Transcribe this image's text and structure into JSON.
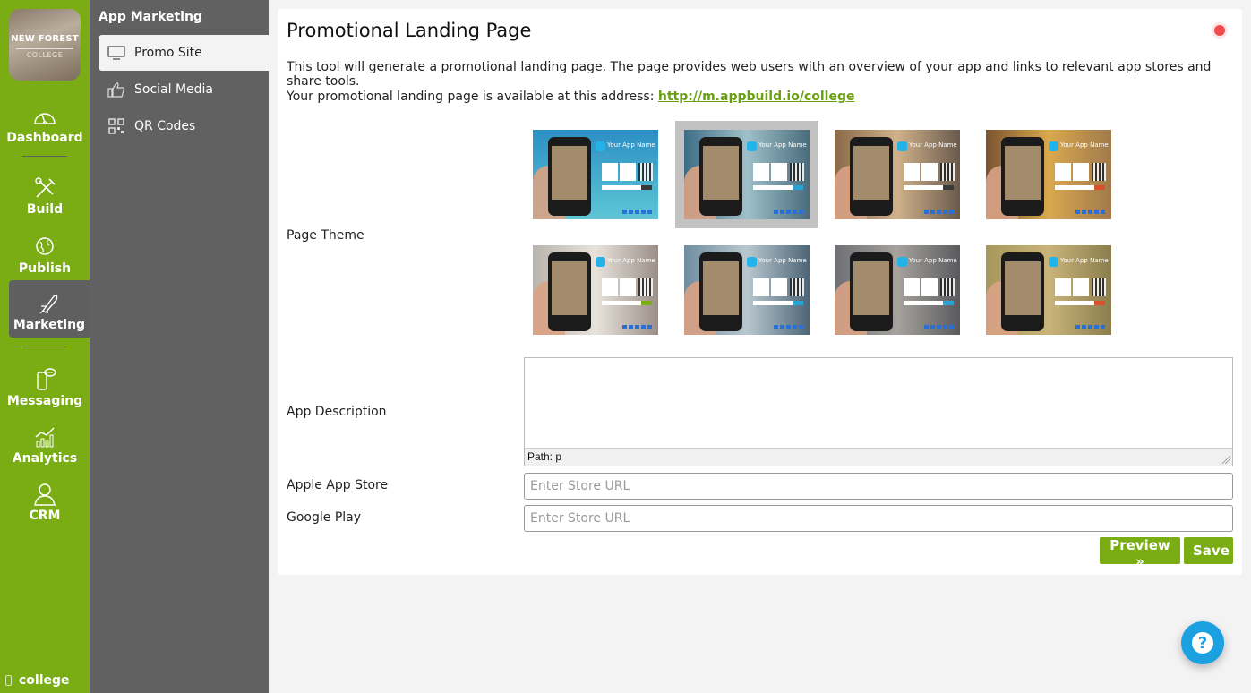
{
  "brand": {
    "logo_line1": "NEW FOREST",
    "logo_line2": "COLLEGE",
    "accent": "#7aac14",
    "subnav_bg": "#616161"
  },
  "nav": {
    "items": [
      {
        "label": "Dashboard",
        "icon": "gauge-icon"
      },
      {
        "label": "Build",
        "icon": "tools-icon"
      },
      {
        "label": "Publish",
        "icon": "globe-icon"
      },
      {
        "label": "Marketing",
        "icon": "rocket-icon",
        "active": true
      },
      {
        "label": "Messaging",
        "icon": "phone-chat-icon"
      },
      {
        "label": "Analytics",
        "icon": "chart-icon"
      },
      {
        "label": "CRM",
        "icon": "user-icon"
      }
    ],
    "footer_app": "college"
  },
  "subnav": {
    "title": "App Marketing",
    "items": [
      {
        "label": "Promo Site",
        "icon": "monitor-icon",
        "active": true
      },
      {
        "label": "Social Media",
        "icon": "thumbs-up-icon"
      },
      {
        "label": "QR Codes",
        "icon": "qr-code-icon"
      }
    ]
  },
  "page": {
    "title": "Promotional Landing Page",
    "status_color": "#f24b4b",
    "description": "This tool will generate a promotional landing page. The page provides web users with an overview of your app and links to relevant app stores and share tools.",
    "address_prefix": "Your promotional landing page is available at this address: ",
    "address_link": "http://m.appbuild.io/college"
  },
  "form": {
    "theme_label": "Page Theme",
    "themes": [
      {
        "app_name": "Your App Name",
        "bg": "linear-gradient(180deg,#2c8fc4,#5ec6d6)",
        "btn": "#3a3a3a",
        "selected": false
      },
      {
        "app_name": "Your App Name",
        "bg": "linear-gradient(90deg,#3d6c86,#9fc0c9,#496b7c)",
        "btn": "#27a3d6",
        "selected": true
      },
      {
        "app_name": "Your App Name",
        "bg": "linear-gradient(90deg,#8a6a48,#cfb18a,#6a5a4c)",
        "btn": "#3a3a3a",
        "selected": false
      },
      {
        "app_name": "Your App Name",
        "bg": "linear-gradient(90deg,#7a5430,#d9a84e,#a07a4c)",
        "btn": "#d8512a",
        "selected": false
      },
      {
        "app_name": "Your App Name",
        "bg": "linear-gradient(90deg,#b8b4ad,#e7e3dc,#9a8f88)",
        "btn": "#7aac14",
        "selected": false
      },
      {
        "app_name": "Your App Name",
        "bg": "linear-gradient(90deg,#6f8da0,#b9c8cf,#4d6577)",
        "btn": "#27a3d6",
        "selected": false
      },
      {
        "app_name": "Your App Name",
        "bg": "linear-gradient(90deg,#6d6f74,#a6a39d,#5a5a5e)",
        "btn": "#27a3d6",
        "selected": false
      },
      {
        "app_name": "Your App Name",
        "bg": "linear-gradient(90deg,#a6975a,#c9b47a,#8b7d4e)",
        "btn": "#d8512a",
        "selected": false
      }
    ],
    "description_label": "App Description",
    "description_value": "",
    "editor_path": "Path: p",
    "apple_label": "Apple App Store",
    "apple_value": "",
    "apple_placeholder": "Enter Store URL",
    "google_label": "Google Play",
    "google_value": "",
    "google_placeholder": "Enter Store URL",
    "preview_label": "Preview »",
    "save_label": "Save"
  },
  "help": {
    "icon": "help-icon",
    "glyph": "?"
  }
}
